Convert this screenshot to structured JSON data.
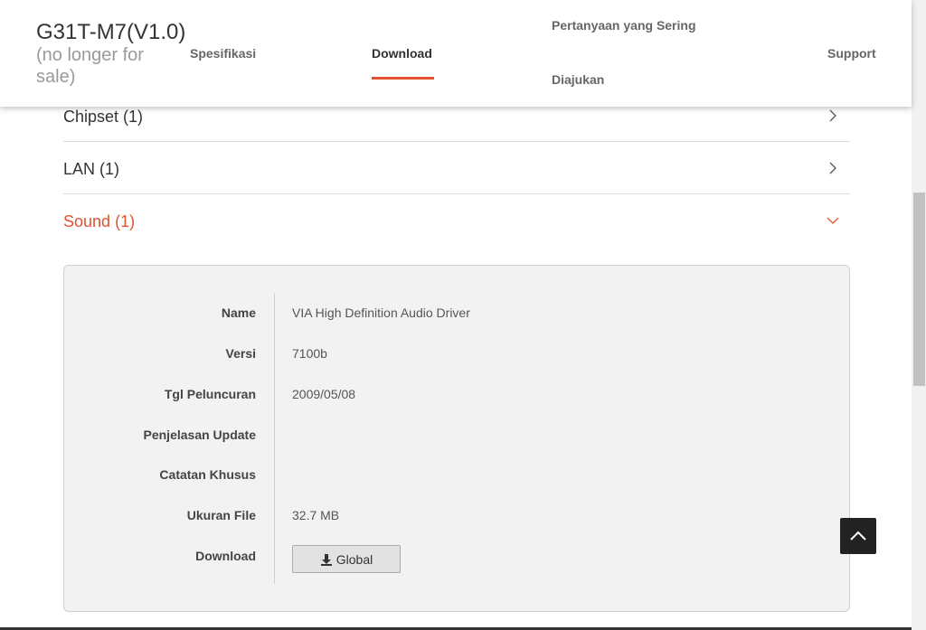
{
  "header": {
    "product_title": "G31T-M7(V1.0)",
    "product_status": "(no longer for sale)",
    "tabs": [
      {
        "label": "Spesifikasi"
      },
      {
        "label": "Download",
        "active": true
      },
      {
        "label_line1": "Pertanyaan yang Sering",
        "label_line2": "Diajukan"
      },
      {
        "label": "Support"
      }
    ]
  },
  "categories": [
    {
      "label": "Chipset",
      "count": "(1)",
      "expanded": false
    },
    {
      "label": "LAN",
      "count": "(1)",
      "expanded": false
    },
    {
      "label": "Sound",
      "count": "(1)",
      "expanded": true
    }
  ],
  "driver": {
    "name_label": "Name",
    "name_value": "VIA High Definition Audio Driver",
    "version_label": "Versi",
    "version_value": "7100b",
    "release_label": "Tgl Peluncuran",
    "release_value": "2009/05/08",
    "update_label": "Penjelasan Update",
    "update_value": "",
    "notes_label": "Catatan Khusus",
    "notes_value": "",
    "size_label": "Ukuran File",
    "size_value": "32.7 MB",
    "download_label": "Download",
    "download_button": "Global"
  },
  "colors": {
    "accent": "#e3512f",
    "panel_bg": "#f2f2f2",
    "back_to_top_bg": "#222222"
  },
  "icons": {
    "download": "download-icon",
    "chevron_right": "chevron-right-icon",
    "chevron_down": "chevron-down-icon",
    "back_to_top": "chevron-up-icon"
  }
}
